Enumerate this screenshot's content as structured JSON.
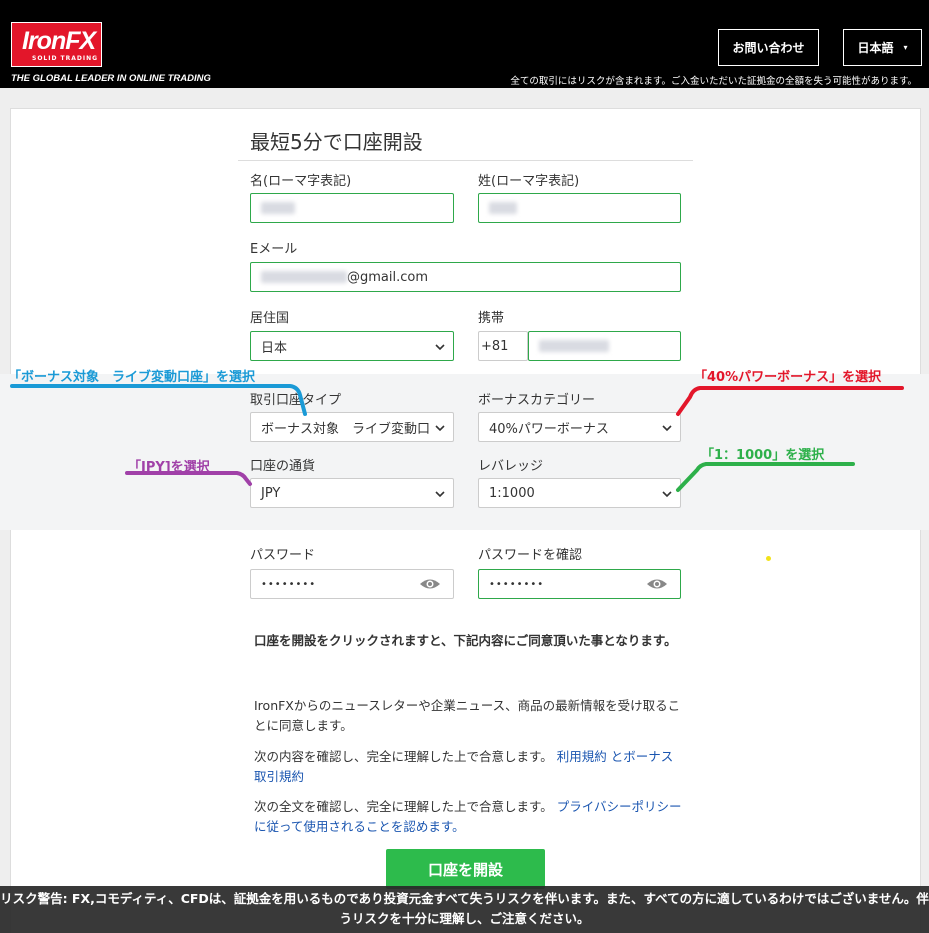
{
  "header": {
    "logo_text": "IronFX",
    "logo_sub": "SOLID TRADING",
    "tagline": "THE GLOBAL LEADER IN ONLINE TRADING",
    "risk_notice": "全ての取引にはリスクが含まれます。ご入金いただいた証拠金の全額を失う可能性があります。",
    "contact_label": "お問い合わせ",
    "language_label": "日本語"
  },
  "form": {
    "title": "最短5分で口座開設",
    "first_name_label": "名(ローマ字表記)",
    "last_name_label": "姓(ローマ字表記)",
    "email_label": "Eメール",
    "email_suffix": "@gmail.com",
    "country_label": "居住国",
    "country_value": "日本",
    "phone_label": "携帯",
    "phone_code": "+81",
    "account_type_label": "取引口座タイプ",
    "account_type_value": "ボーナス対象　ライブ変動口",
    "bonus_category_label": "ボーナスカテゴリー",
    "bonus_category_value": "40%パワーボーナス",
    "currency_label": "口座の通貨",
    "currency_value": "JPY",
    "leverage_label": "レバレッジ",
    "leverage_value": "1:1000",
    "password_label": "パスワード",
    "password_value": "••••••••",
    "password_confirm_label": "パスワードを確認",
    "password_confirm_value": "••••••••"
  },
  "terms": {
    "agree_heading": "口座を開設をクリックされますと、下記内容にご同意頂いた事となります。",
    "newsletter": "IronFXからのニュースレターや企業ニュース、商品の最新情報を受け取ることに同意します。",
    "terms_prefix": "次の内容を確認し、完全に理解した上で合意します。",
    "terms_link": "利用規約 とボーナス取引規約",
    "privacy_prefix": "次の全文を確認し、完全に理解した上で合意します。",
    "privacy_link": "プライバシーポリシーに従って使用されることを認めます。"
  },
  "submit_label": "口座を開設",
  "annotations": {
    "account_type": "「ボーナス対象　ライブ変動口座」を選択",
    "bonus": "「40%パワーボーナス」を選択",
    "currency": "「JPY]を選択",
    "leverage": "「1：1000」を選択"
  },
  "risk_warning": "リスク警告: FX,コモディティ、CFDは、証拠金を用いるものであり投資元金すべて失うリスクを伴います。また、すべての方に適しているわけではございません。伴うリスクを十分に理解し、ご注意ください。",
  "colors": {
    "brand_red": "#e3162a",
    "field_border": "#2ea84a",
    "button_green": "#2dbb4c",
    "annotation_blue": "#1a9ad6",
    "annotation_red": "#e3162a",
    "annotation_purple": "#a040a8",
    "annotation_green": "#2db04a"
  }
}
